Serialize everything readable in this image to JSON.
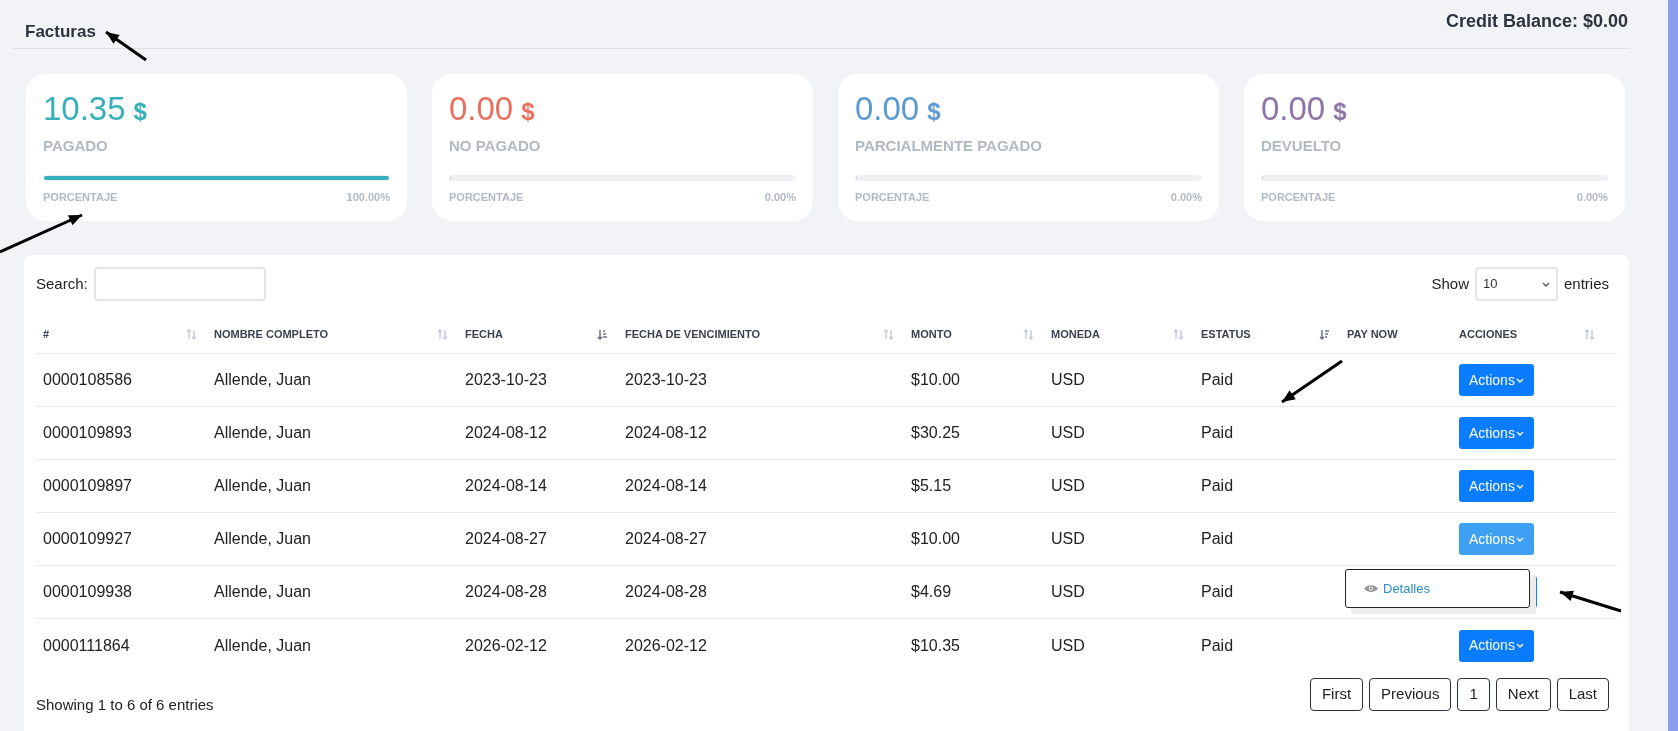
{
  "header": {
    "title": "Facturas",
    "credit_balance": "Credit Balance: $0.00"
  },
  "cards": [
    {
      "value": "10.35",
      "currency": "$",
      "label": "PAGADO",
      "color": "#36b0bb",
      "level": 1,
      "caption": "PORCENTAJE",
      "percent": "100.00%"
    },
    {
      "value": "0.00",
      "currency": "$",
      "label": "NO PAGADO",
      "color": "#e8705f",
      "level": 0,
      "caption": "PORCENTAJE",
      "percent": "0.00%"
    },
    {
      "value": "0.00",
      "currency": "$",
      "label": "PARCIALMENTE PAGADO",
      "color": "#5b9bd1",
      "level": 0,
      "caption": "PORCENTAJE",
      "percent": "0.00%"
    },
    {
      "value": "0.00",
      "currency": "$",
      "label": "DEVUELTO",
      "color": "#8d75a8",
      "level": 0,
      "caption": "PORCENTAJE",
      "percent": "0.00%"
    }
  ],
  "table": {
    "search_label": "Search:",
    "show_label": "Show",
    "page_size": "10",
    "entries_label": "entries",
    "columns": [
      {
        "label": "#",
        "kind": "sortable"
      },
      {
        "label": "NOMBRE COMPLETO",
        "kind": "sortable"
      },
      {
        "label": "FECHA",
        "kind": "ascending"
      },
      {
        "label": "FECHA DE VENCIMIENTO",
        "kind": "sortable"
      },
      {
        "label": "MONTO",
        "kind": "sortable"
      },
      {
        "label": "MONEDA",
        "kind": "sortable"
      },
      {
        "label": "ESTATUS",
        "kind": "descending"
      },
      {
        "label": "PAY NOW",
        "kind": "plain"
      },
      {
        "label": "ACCIONES",
        "kind": "sortable"
      }
    ],
    "rows": [
      {
        "cells": [
          "0000108586",
          "Allende, Juan",
          "2023-10-23",
          "2023-10-23",
          "$10.00",
          "USD",
          "Paid"
        ],
        "action": {
          "label": "Actions",
          "active": false
        }
      },
      {
        "cells": [
          "0000109893",
          "Allende, Juan",
          "2024-08-12",
          "2024-08-12",
          "$30.25",
          "USD",
          "Paid"
        ],
        "action": {
          "label": "Actions",
          "active": false
        }
      },
      {
        "cells": [
          "0000109897",
          "Allende, Juan",
          "2024-08-14",
          "2024-08-14",
          "$5.15",
          "USD",
          "Paid"
        ],
        "action": {
          "label": "Actions",
          "active": false
        }
      },
      {
        "cells": [
          "0000109927",
          "Allende, Juan",
          "2024-08-27",
          "2024-08-27",
          "$10.00",
          "USD",
          "Paid"
        ],
        "action": {
          "label": "Actions",
          "active": true
        },
        "menu": [
          {
            "label": "Detalles"
          }
        ]
      },
      {
        "cells": [
          "0000109938",
          "Allende, Juan",
          "2024-08-28",
          "2024-08-28",
          "$4.69",
          "USD",
          "Paid"
        ],
        "action": {
          "covered": true
        }
      },
      {
        "cells": [
          "0000111864",
          "Allende, Juan",
          "2026-02-12",
          "2026-02-12",
          "$10.35",
          "USD",
          "Paid"
        ],
        "action": {
          "label": "Actions",
          "active": false
        }
      }
    ],
    "info": "Showing 1 to 6 of 6 entries",
    "pagination": [
      {
        "label": "First"
      },
      {
        "label": "Previous"
      },
      {
        "label": "1"
      },
      {
        "label": "Next"
      },
      {
        "label": "Last"
      }
    ]
  }
}
